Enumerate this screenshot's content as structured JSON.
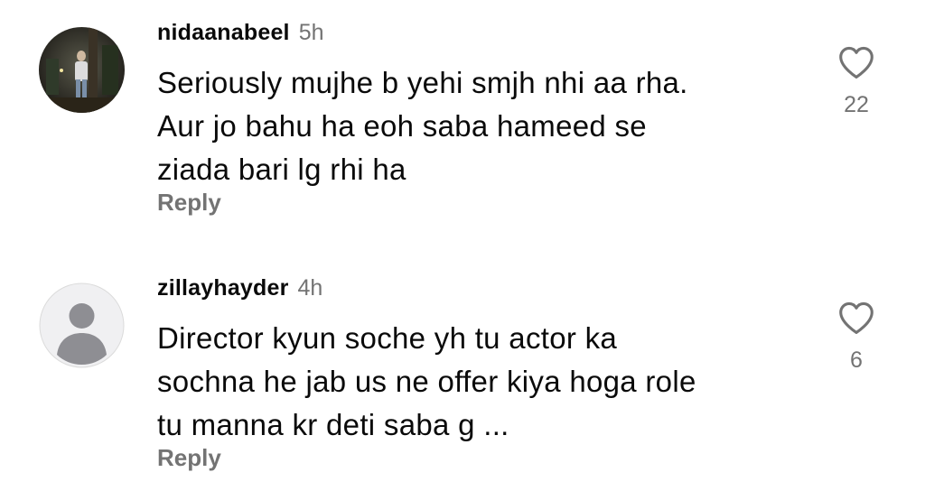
{
  "comments": [
    {
      "username": "nidaanabeel",
      "time": "5h",
      "text": "Seriously mujhe b yehi smjh nhi aa rha.\nAur jo bahu ha eoh saba hameed se\nziada bari lg rhi ha",
      "reply_label": "Reply",
      "likes": "22",
      "avatar_icon": "profile-photo",
      "like_icon": "heart-outline-icon"
    },
    {
      "username": "zillayhayder",
      "time": "4h",
      "text": "Director kyun soche yh tu actor ka\nsochna he jab us ne offer kiya hoga role\ntu manna kr deti saba g ...",
      "reply_label": "Reply",
      "likes": "6",
      "avatar_icon": "default-avatar-icon",
      "like_icon": "heart-outline-icon"
    }
  ],
  "colors": {
    "text_primary": "#0a0a0a",
    "text_secondary": "#737373",
    "background": "#ffffff",
    "default_avatar_bg": "#f0f0f2",
    "default_avatar_fg": "#8e8e93"
  }
}
